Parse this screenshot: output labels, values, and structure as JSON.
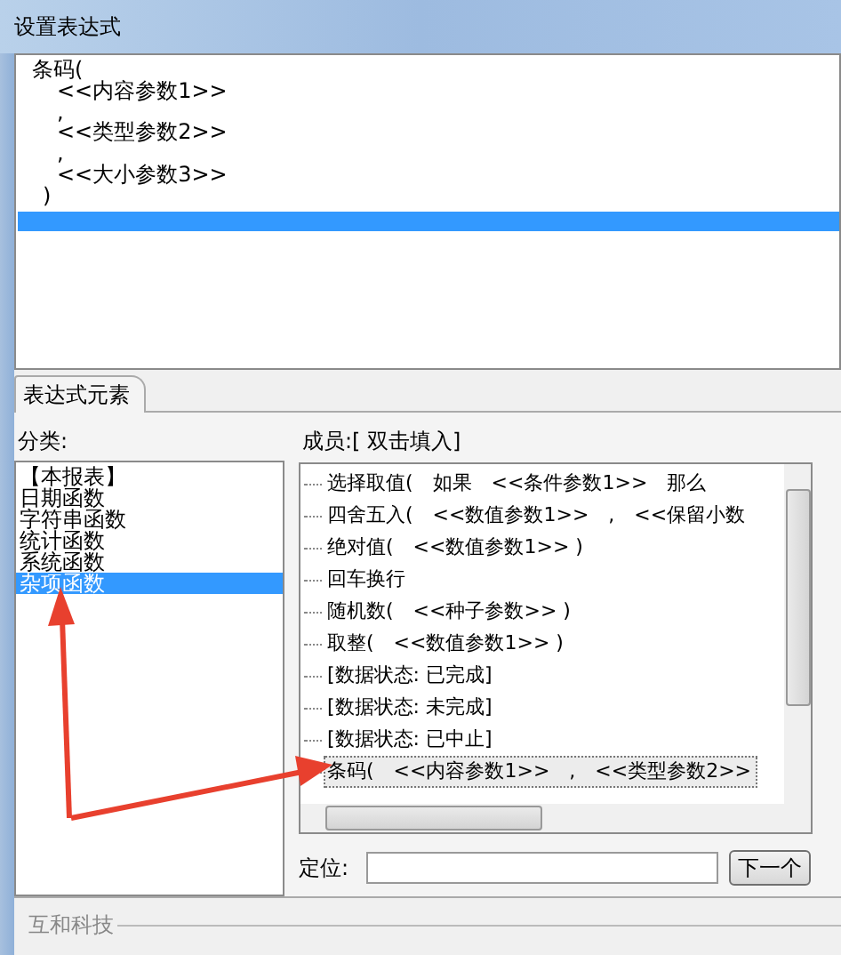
{
  "window": {
    "title": "设置表达式"
  },
  "editor": {
    "lines": [
      "条码(",
      "<<内容参数1>>",
      ",",
      "<<类型参数2>>",
      ",",
      "<<大小参数3>>",
      ")"
    ]
  },
  "tabs": [
    {
      "label": "表达式元素",
      "selected": true
    }
  ],
  "categories": {
    "label": "分类:",
    "items": [
      {
        "label": "【本报表】",
        "selected": false
      },
      {
        "label": "日期函数",
        "selected": false
      },
      {
        "label": "字符串函数",
        "selected": false
      },
      {
        "label": "统计函数",
        "selected": false
      },
      {
        "label": "系统函数",
        "selected": false
      },
      {
        "label": "杂项函数",
        "selected": true
      }
    ]
  },
  "members": {
    "label": "成员:[ 双击填入]",
    "items": [
      {
        "label": "选择取值(　如果　<<条件参数1>>　那么",
        "selected": false
      },
      {
        "label": "四舍五入(　<<数值参数1>>　,　<<保留小数",
        "selected": false
      },
      {
        "label": "绝对值(　<<数值参数1>> )",
        "selected": false
      },
      {
        "label": "回车换行",
        "selected": false
      },
      {
        "label": "随机数(　<<种子参数>> )",
        "selected": false
      },
      {
        "label": "取整(　<<数值参数1>> )",
        "selected": false
      },
      {
        "label": "[数据状态: 已完成]",
        "selected": false
      },
      {
        "label": "[数据状态: 未完成]",
        "selected": false
      },
      {
        "label": "[数据状态: 已中止]",
        "selected": false
      },
      {
        "label": "条码(　<<内容参数1>>　,　<<类型参数2>>",
        "selected": true
      }
    ]
  },
  "locate": {
    "label": "定位:",
    "button": "下一个"
  },
  "footer": {
    "text": "互和科技"
  }
}
